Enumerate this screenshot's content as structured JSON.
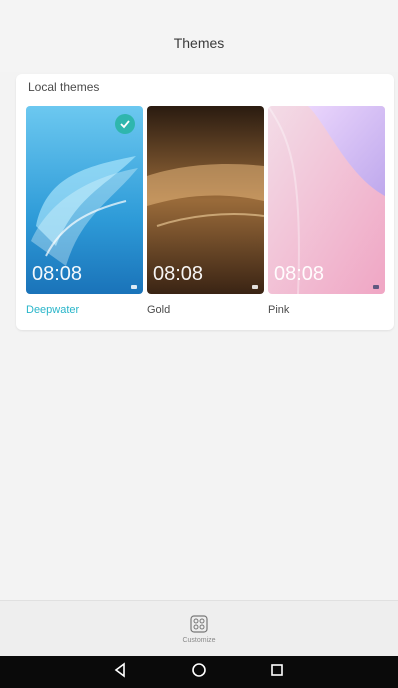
{
  "header": {
    "title": "Themes"
  },
  "local": {
    "title": "Local themes",
    "themes": [
      {
        "name": "Deepwater",
        "time": "08:08",
        "selected": true,
        "name_color": "#29b5c9"
      },
      {
        "name": "Gold",
        "time": "08:08",
        "selected": false,
        "name_color": "#555555"
      },
      {
        "name": "Pink",
        "time": "08:08",
        "selected": false,
        "name_color": "#555555"
      }
    ]
  },
  "bottom": {
    "label": "Customize",
    "icon": "customize-grid-icon"
  },
  "navbar": {
    "back": "back-icon",
    "home": "home-icon",
    "recents": "recents-icon"
  },
  "colors": {
    "accent": "#2fb6ad",
    "background": "#f3f3f3"
  }
}
